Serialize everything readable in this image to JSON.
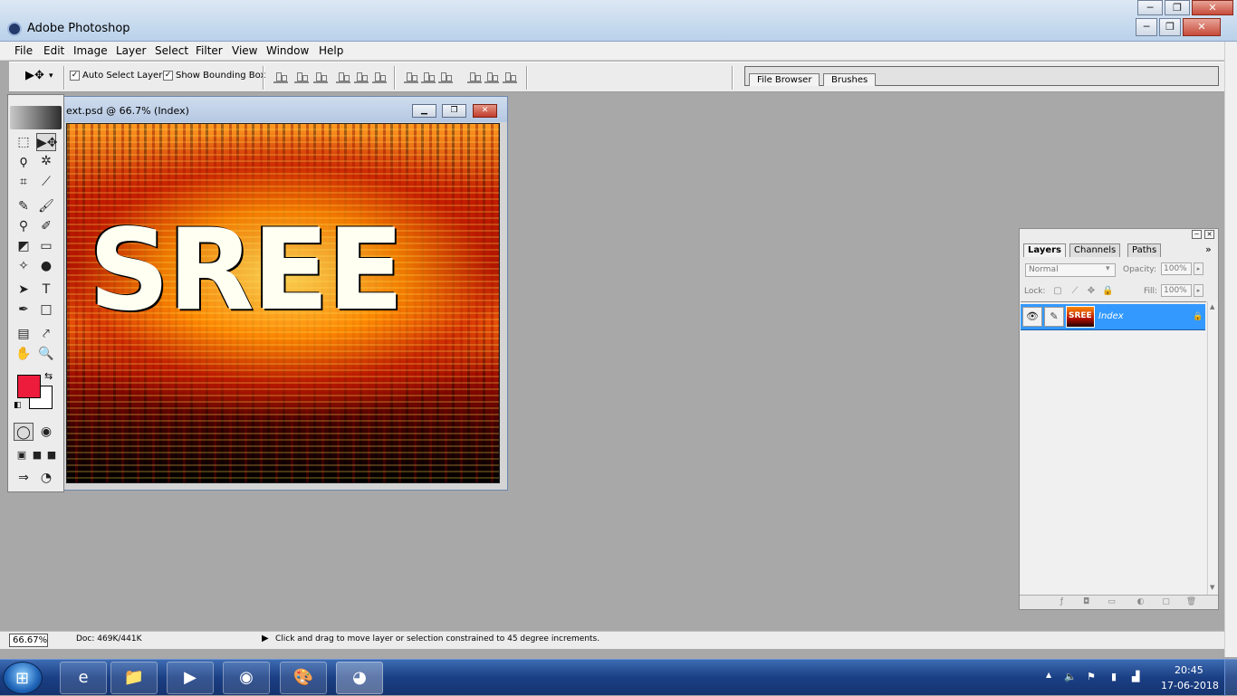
{
  "window": {
    "title": "Adobe Photoshop",
    "caption_min": "─",
    "caption_max": "❐",
    "caption_close": "✕"
  },
  "menu": [
    "File",
    "Edit",
    "Image",
    "Layer",
    "Select",
    "Filter",
    "View",
    "Window",
    "Help"
  ],
  "options": {
    "tool_glyph": "▶✥",
    "dropdown_glyph": "▾",
    "auto_select_label": "Auto Select Layer",
    "auto_select_checked": true,
    "show_bbox_label": "Show Bounding Box",
    "show_bbox_checked": true,
    "check_glyph": "✓",
    "palette_well_tabs": [
      "File Browser",
      "Brushes"
    ]
  },
  "toolbox": {
    "tools": [
      {
        "name": "marquee",
        "glyph": "⬚",
        "selected": false
      },
      {
        "name": "move",
        "glyph": "▶✥",
        "selected": true
      },
      {
        "name": "lasso",
        "glyph": "ϙ",
        "selected": false
      },
      {
        "name": "magic-wand",
        "glyph": "✲",
        "selected": false
      },
      {
        "name": "crop",
        "glyph": "⌗",
        "selected": false
      },
      {
        "name": "slice",
        "glyph": "⟋",
        "selected": false
      },
      {
        "name": "healing-brush",
        "glyph": "✎",
        "selected": false
      },
      {
        "name": "brush",
        "glyph": "🖌",
        "selected": false
      },
      {
        "name": "clone-stamp",
        "glyph": "⚲",
        "selected": false
      },
      {
        "name": "history-brush",
        "glyph": "✐",
        "selected": false
      },
      {
        "name": "eraser",
        "glyph": "◩",
        "selected": false
      },
      {
        "name": "gradient",
        "glyph": "▭",
        "selected": false
      },
      {
        "name": "blur",
        "glyph": "✧",
        "selected": false
      },
      {
        "name": "dodge",
        "glyph": "●",
        "selected": false
      },
      {
        "name": "path-select",
        "glyph": "➤",
        "selected": false
      },
      {
        "name": "type",
        "glyph": "T",
        "selected": false
      },
      {
        "name": "pen",
        "glyph": "✒",
        "selected": false
      },
      {
        "name": "shape",
        "glyph": "□",
        "selected": false
      },
      {
        "name": "notes",
        "glyph": "▤",
        "selected": false
      },
      {
        "name": "eyedropper",
        "glyph": "⤤",
        "selected": false
      },
      {
        "name": "hand",
        "glyph": "✋",
        "selected": false
      },
      {
        "name": "zoom",
        "glyph": "🔍",
        "selected": false
      }
    ],
    "foreground_color": "#ed1c3c",
    "background_color": "#ffffff",
    "swap_glyph": "⇆",
    "default_glyph": "◧",
    "mask_glyph_std": "◯",
    "mask_glyph_quick": "◉",
    "screen_glyphs": [
      "▣",
      "■",
      "■"
    ],
    "jump_glyph": "⇒",
    "imageready_glyph": "◔"
  },
  "document": {
    "title": "ext.psd @ 66.7% (Index)",
    "minimize": "▁",
    "restore": "❐",
    "close": "✕",
    "canvas_text": "SREE"
  },
  "layers_panel": {
    "tabs": [
      {
        "label": "Layers",
        "active": true
      },
      {
        "label": "Channels",
        "active": false
      },
      {
        "label": "Paths",
        "active": false
      }
    ],
    "menu_glyph": "»",
    "blend_mode": "Normal",
    "opacity_label": "Opacity:",
    "opacity_value": "100%",
    "lock_label": "Lock:",
    "fill_label": "Fill:",
    "fill_value": "100%",
    "step_glyph": "▸",
    "lock_glyphs": [
      "▢",
      "⟋",
      "✥",
      "🔒"
    ],
    "layer": {
      "name": "Index",
      "eye": "👁",
      "brush": "✎",
      "locked_glyph": "🔒"
    },
    "bottom_glyphs": [
      "ƒ",
      "◘",
      "▭",
      "◐",
      "▢",
      "🗑"
    ],
    "scroll_up": "▲",
    "scroll_down": "▼"
  },
  "statusbar": {
    "zoom": "66.67%",
    "doc_size": "Doc: 469K/441K",
    "arrow": "▶",
    "tip": "Click and drag to move layer or selection constrained to 45 degree increments."
  },
  "taskbar": {
    "start_glyph": "⊞",
    "buttons": [
      {
        "name": "internet-explorer",
        "glyph": "e",
        "active": false
      },
      {
        "name": "file-explorer",
        "glyph": "📁",
        "active": false
      },
      {
        "name": "media-player",
        "glyph": "▶",
        "active": false
      },
      {
        "name": "firefox",
        "glyph": "◉",
        "active": false
      },
      {
        "name": "paint",
        "glyph": "🎨",
        "active": false
      },
      {
        "name": "photoshop",
        "glyph": "◕",
        "active": true
      }
    ],
    "tray": {
      "up": "▲",
      "volume": "🔈",
      "flag": "⚑",
      "battery": "▮",
      "signal": "▟"
    },
    "time": "20:45",
    "date": "17-06-2018"
  }
}
